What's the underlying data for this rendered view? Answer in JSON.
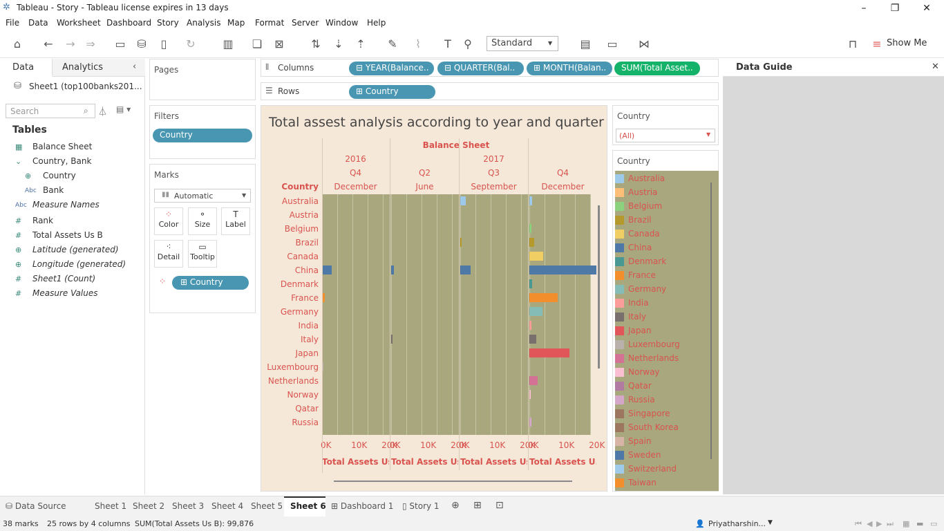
{
  "window": {
    "title": "Tableau - Story - Tableau license expires in 13 days"
  },
  "menu": [
    "File",
    "Data",
    "Worksheet",
    "Dashboard",
    "Story",
    "Analysis",
    "Map",
    "Format",
    "Server",
    "Window",
    "Help"
  ],
  "toolbar": {
    "view_mode": "Standard",
    "show_me": "Show Me"
  },
  "left_pane": {
    "tab_data": "Data",
    "tab_analytics": "Analytics",
    "datasource": "Sheet1 (top100banks201...",
    "search_placeholder": "Search",
    "tables_heading": "Tables",
    "fields": [
      {
        "label": "Balance Sheet",
        "type": "calendar-icon"
      },
      {
        "label": "Country, Bank",
        "type": "hierarchy-icon"
      },
      {
        "label": "Country",
        "type": "globe-icon"
      },
      {
        "label": "Bank",
        "type": "abc-icon"
      },
      {
        "label": "Measure Names",
        "type": "abc-icon"
      },
      {
        "label": "Rank",
        "type": "hash-icon"
      },
      {
        "label": "Total Assets Us B",
        "type": "hash-icon"
      },
      {
        "label": "Latitude (generated)",
        "type": "globe-icon"
      },
      {
        "label": "Longitude (generated)",
        "type": "globe-icon"
      },
      {
        "label": "Sheet1 (Count)",
        "type": "hash-icon"
      },
      {
        "label": "Measure Values",
        "type": "hash-icon"
      }
    ]
  },
  "pages": {
    "title": "Pages"
  },
  "filters": {
    "title": "Filters",
    "pill": "Country"
  },
  "marks": {
    "title": "Marks",
    "type": "Automatic",
    "buttons": [
      "Color",
      "Size",
      "Label",
      "Detail",
      "Tooltip"
    ],
    "color_pill": "Country"
  },
  "shelves": {
    "columns_label": "Columns",
    "rows_label": "Rows",
    "columns": [
      "YEAR(Balance..",
      "QUARTER(Bal..",
      "MONTH(Balan..",
      "SUM(Total Asset.."
    ],
    "rows": [
      "Country"
    ]
  },
  "filter_card": {
    "title": "Country",
    "value": "(All)"
  },
  "legend": {
    "title": "Country",
    "items": [
      {
        "name": "Australia",
        "color": "#9ecae9"
      },
      {
        "name": "Austria",
        "color": "#ffbf79"
      },
      {
        "name": "Belgium",
        "color": "#8cd17d"
      },
      {
        "name": "Brazil",
        "color": "#b6992d"
      },
      {
        "name": "Canada",
        "color": "#f1ce63"
      },
      {
        "name": "China",
        "color": "#4e79a7"
      },
      {
        "name": "Denmark",
        "color": "#499894"
      },
      {
        "name": "France",
        "color": "#f28e2b"
      },
      {
        "name": "Germany",
        "color": "#86bcb6"
      },
      {
        "name": "India",
        "color": "#ff9d9a"
      },
      {
        "name": "Italy",
        "color": "#79706e"
      },
      {
        "name": "Japan",
        "color": "#e15759"
      },
      {
        "name": "Luxembourg",
        "color": "#bab0ac"
      },
      {
        "name": "Netherlands",
        "color": "#d37295"
      },
      {
        "name": "Norway",
        "color": "#fabfd2"
      },
      {
        "name": "Qatar",
        "color": "#b07aa1"
      },
      {
        "name": "Russia",
        "color": "#d4a6c8"
      },
      {
        "name": "Singapore",
        "color": "#9d7660"
      },
      {
        "name": "South Korea",
        "color": "#9d7660"
      },
      {
        "name": "Spain",
        "color": "#d7b5a6"
      },
      {
        "name": "Sweden",
        "color": "#4e79a7"
      },
      {
        "name": "Switzerland",
        "color": "#a0cbe8"
      },
      {
        "name": "Taiwan",
        "color": "#f28e2b"
      }
    ]
  },
  "data_guide": {
    "title": "Data Guide"
  },
  "chart_data": {
    "type": "bar",
    "title": "Total assest analysis according to year and quarter",
    "header_top": "Balance Sheet",
    "row_header": "Country",
    "panes": [
      {
        "year": "2016",
        "quarter": "Q4",
        "month": "December"
      },
      {
        "year": "2017",
        "quarter": "Q2",
        "month": "June"
      },
      {
        "year": "2017",
        "quarter": "Q3",
        "month": "September"
      },
      {
        "year": "2017",
        "quarter": "Q4",
        "month": "December"
      }
    ],
    "year_labels": [
      "2016",
      "2017"
    ],
    "ticks": [
      "0K",
      "10K",
      "20K"
    ],
    "xlim": [
      0,
      22000
    ],
    "axis_titles": [
      "Total Assets Us B",
      "Total Assets Us B",
      "Total Assets Us B",
      "Total Assets U.."
    ],
    "categories": [
      "Australia",
      "Austria",
      "Belgium",
      "Brazil",
      "Canada",
      "China",
      "Denmark",
      "France",
      "Germany",
      "India",
      "Italy",
      "Japan",
      "Luxembourg",
      "Netherlands",
      "Norway",
      "Qatar",
      "Russia"
    ],
    "series": [
      {
        "values": [
          0,
          0,
          0,
          0,
          0,
          3200,
          0,
          900,
          0,
          0,
          0,
          0,
          400,
          0,
          0,
          0,
          0
        ]
      },
      {
        "values": [
          0,
          0,
          0,
          0,
          0,
          1000,
          0,
          0,
          0,
          0,
          300,
          0,
          0,
          0,
          0,
          0,
          0
        ]
      },
      {
        "values": [
          1800,
          0,
          0,
          500,
          0,
          3400,
          0,
          0,
          0,
          0,
          0,
          0,
          0,
          0,
          0,
          0,
          0
        ]
      },
      {
        "values": [
          900,
          0,
          600,
          1500,
          4600,
          22000,
          800,
          9200,
          4200,
          700,
          2200,
          13200,
          0,
          2700,
          400,
          0,
          700
        ]
      }
    ]
  },
  "bottom_tabs": [
    "Data Source",
    "Sheet 1",
    "Sheet 2",
    "Sheet 3",
    "Sheet 4",
    "Sheet 5",
    "Sheet 6",
    "Dashboard 1",
    "Story 1"
  ],
  "status": {
    "marks": "38 marks",
    "dims": "25 rows by 4 columns",
    "sum": "SUM(Total Assets Us B): 99,876",
    "user": "Priyatharshin..."
  }
}
